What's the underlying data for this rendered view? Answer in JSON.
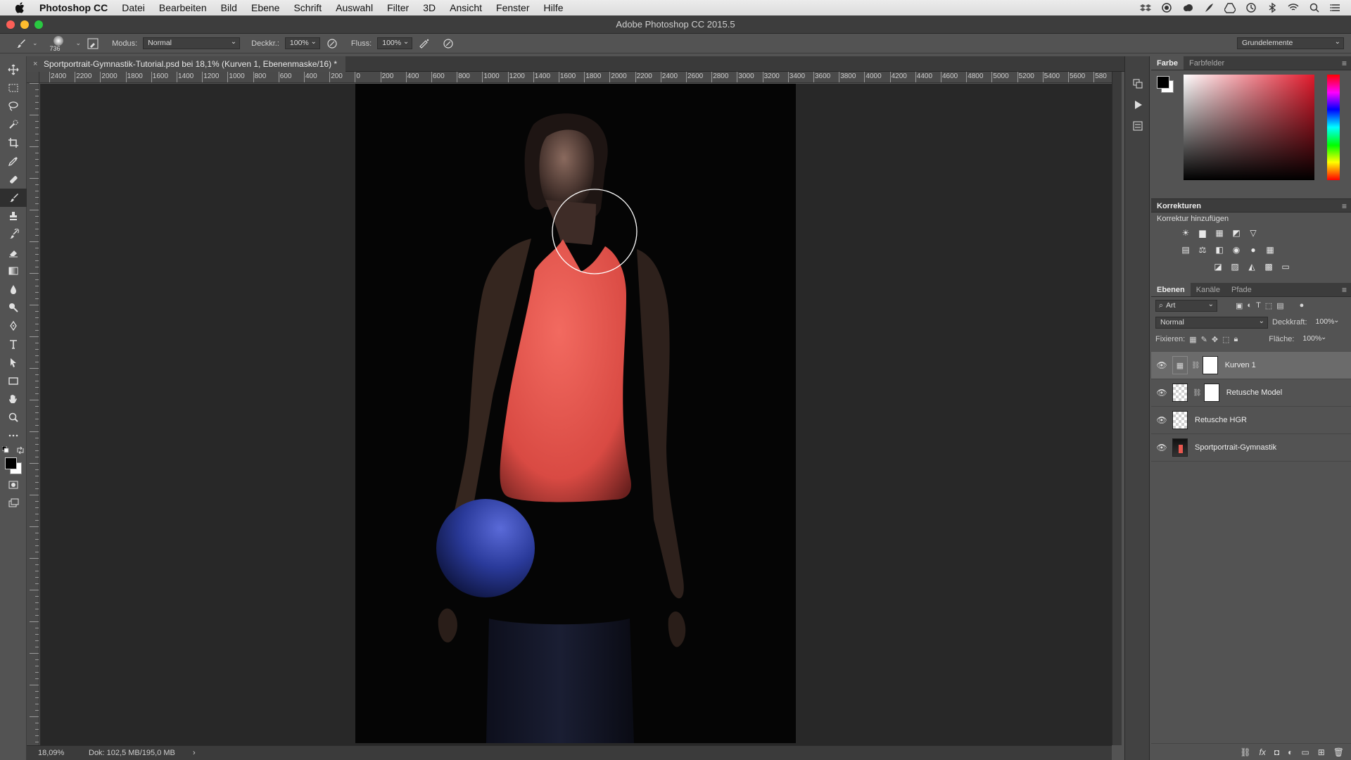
{
  "menubar": {
    "app": "Photoshop CC",
    "items": [
      "Datei",
      "Bearbeiten",
      "Bild",
      "Ebene",
      "Schrift",
      "Auswahl",
      "Filter",
      "3D",
      "Ansicht",
      "Fenster",
      "Hilfe"
    ]
  },
  "window": {
    "title": "Adobe Photoshop CC 2015.5"
  },
  "options": {
    "brush_size": "736",
    "mode_label": "Modus:",
    "mode_value": "Normal",
    "opacity_label": "Deckkr.:",
    "opacity_value": "100%",
    "flow_label": "Fluss:",
    "flow_value": "100%",
    "workspace": "Grundelemente"
  },
  "document": {
    "tab_title": "Sportportrait-Gymnastik-Tutorial.psd bei 18,1% (Kurven 1, Ebenenmaske/16) *",
    "close": "×",
    "zoom": "18,09%",
    "doc_size": "Dok: 102,5 MB/195,0 MB",
    "status_arrow": "›"
  },
  "ruler": {
    "labels": [
      "2400",
      "2200",
      "2000",
      "1800",
      "1600",
      "1400",
      "1200",
      "1000",
      "800",
      "600",
      "400",
      "200",
      "0",
      "200",
      "400",
      "600",
      "800",
      "1000",
      "1200",
      "1400",
      "1600",
      "1800",
      "2000",
      "2200",
      "2400",
      "2600",
      "2800",
      "3000",
      "3200",
      "3400",
      "3600",
      "3800",
      "4000",
      "4200",
      "4400",
      "4600",
      "4800",
      "5000",
      "5200",
      "5400",
      "5600",
      "580"
    ]
  },
  "color_panel": {
    "tabs": [
      "Farbe",
      "Farbfelder"
    ]
  },
  "adjustments": {
    "title": "Korrekturen",
    "subtitle": "Korrektur hinzufügen"
  },
  "layers_panel": {
    "tabs": [
      "Ebenen",
      "Kanäle",
      "Pfade"
    ],
    "filter": "Art",
    "blend_mode": "Normal",
    "opacity_label": "Deckkraft:",
    "opacity_value": "100%",
    "lock_label": "Fixieren:",
    "fill_label": "Fläche:",
    "fill_value": "100%",
    "layers": [
      {
        "name": "Kurven 1",
        "selected": true
      },
      {
        "name": "Retusche Model",
        "selected": false
      },
      {
        "name": "Retusche HGR",
        "selected": false
      },
      {
        "name": "Sportportrait-Gymnastik",
        "selected": false
      }
    ]
  },
  "colors": {
    "accent_tank": "#e8574f",
    "ball": "#2a3a9a",
    "canvas_bg": "#282828"
  }
}
